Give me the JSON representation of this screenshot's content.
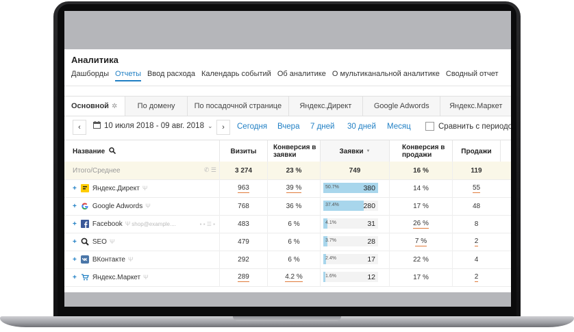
{
  "app": {
    "title": "Аналитика",
    "nav": [
      "Дашборды",
      "Отчеты",
      "Ввод расхода",
      "Календарь событий",
      "Об аналитике",
      "О мультиканальной аналитике",
      "Сводный отчет"
    ],
    "active_nav": "Отчеты"
  },
  "report_tabs": [
    {
      "label": "Основной",
      "active": true
    },
    {
      "label": "По домену"
    },
    {
      "label": "По посадочной странице"
    },
    {
      "label": "Яндекс.Директ"
    },
    {
      "label": "Google Adwords"
    },
    {
      "label": "Яндекс.Маркет"
    }
  ],
  "toolbar": {
    "prev": "‹",
    "next": "›",
    "date_range": "10 июля 2018 - 09 авг. 2018",
    "quick_ranges": [
      "Сегодня",
      "Вчера",
      "7 дней",
      "30 дней",
      "Месяц"
    ],
    "compare_label": "Сравнить с периодом"
  },
  "table": {
    "headers": {
      "name": "Название",
      "visits": "Визиты",
      "conv_requests": "Конверсия в заявки",
      "requests": "Заявки",
      "conv_sales": "Конверсия в продажи",
      "sales": "Продажи"
    },
    "sort_arrow": "▼",
    "total": {
      "name": "Итого/Среднее",
      "visits": "3 274",
      "conv_requests": "23 %",
      "requests": "749",
      "conv_sales": "16 %",
      "sales": "119"
    },
    "rows": [
      {
        "name": "Яндекс.Директ",
        "icon": "yandex-direct-icon",
        "visits": "963",
        "conv_requests": "39 %",
        "requests": "380",
        "requests_pct_label": "50.7%",
        "requests_pct": 50.7,
        "conv_sales": "14 %",
        "sales": "55",
        "visits_ul": true,
        "conv_req_ul": true,
        "conv_sales_ul": false,
        "sales_ul": true
      },
      {
        "name": "Google Adwords",
        "icon": "google-icon",
        "visits": "768",
        "conv_requests": "36 %",
        "requests": "280",
        "requests_pct_label": "37.4%",
        "requests_pct": 37.4,
        "conv_sales": "17 %",
        "sales": "48",
        "visits_ul": false,
        "conv_req_ul": false,
        "conv_sales_ul": false,
        "sales_ul": false
      },
      {
        "name": "Facebook",
        "icon": "facebook-icon",
        "extra": "shop@example....",
        "visits": "483",
        "conv_requests": "6 %",
        "requests": "31",
        "requests_pct_label": "4.1%",
        "requests_pct": 4.1,
        "conv_sales": "26 %",
        "sales": "8",
        "visits_ul": false,
        "conv_req_ul": false,
        "conv_sales_ul": true,
        "sales_ul": false
      },
      {
        "name": "SEO",
        "icon": "search-icon",
        "visits": "479",
        "conv_requests": "6 %",
        "requests": "28",
        "requests_pct_label": "3.7%",
        "requests_pct": 3.7,
        "conv_sales": "7 %",
        "sales": "2",
        "visits_ul": false,
        "conv_req_ul": false,
        "conv_sales_ul": true,
        "sales_ul": true
      },
      {
        "name": "ВКонтакте",
        "icon": "vk-icon",
        "visits": "292",
        "conv_requests": "6 %",
        "requests": "17",
        "requests_pct_label": "2.4%",
        "requests_pct": 2.4,
        "conv_sales": "22 %",
        "sales": "4",
        "visits_ul": false,
        "conv_req_ul": false,
        "conv_sales_ul": false,
        "sales_ul": false
      },
      {
        "name": "Яндекс.Маркет",
        "icon": "cart-icon",
        "visits": "289",
        "conv_requests": "4.2 %",
        "requests": "12",
        "requests_pct_label": "1.6%",
        "requests_pct": 1.6,
        "conv_sales": "17 %",
        "sales": "2",
        "visits_ul": true,
        "conv_req_ul": true,
        "conv_sales_ul": false,
        "sales_ul": true
      }
    ]
  },
  "colors": {
    "accent": "#1f7fc4",
    "bar": "#a8d6ec",
    "total_row": "#faf7e8",
    "underline": "#e07a3a"
  }
}
